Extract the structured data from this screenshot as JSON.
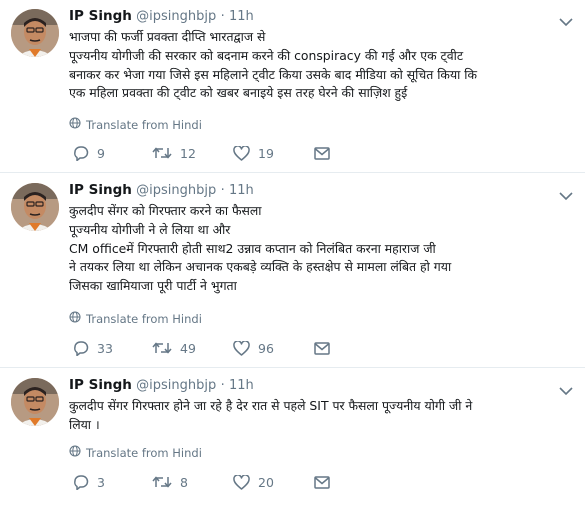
{
  "tweets": [
    {
      "name": "IP Singh",
      "handle": "@ipsinghbjp",
      "dot": "·",
      "time": "11h",
      "lines": [
        "भाजपा की फर्जी प्रवक्ता दीप्ति भारतद्वाज से",
        "पूज्यनीय योगीजी की सरकार को बदनाम करने की conspiracy की गई और एक ट्वीट",
        "बनाकर कर भेजा गया जिसे इस महिलाने ट्वीट किया उसके बाद मीडिया को सूचित किया कि",
        "एक महिला प्रवक्ता की ट्वीट को खबर बनाइये इस तरह घेरने की साज़िश हुई"
      ],
      "translate": "Translate from Hindi",
      "replies": "9",
      "retweets": "12",
      "likes": "19"
    },
    {
      "name": "IP Singh",
      "handle": "@ipsinghbjp",
      "dot": "·",
      "time": "11h",
      "lines": [
        "कुलदीप सेंगर को गिरफ्तार करने का फैसला",
        "पूज्यनीय योगीजी ने ले लिया था और",
        "CM officeमें गिरफ्तारी होती साथ2 उन्नाव कप्तान को निलंबित करना महाराज जी",
        "ने तयकर लिया था लेकिन अचानक एकबड़े व्यक्ति के हस्तक्षेप से मामला लंबित हो गया",
        "जिसका खामियाजा पूरी पार्टी ने भुगता"
      ],
      "translate": "Translate from Hindi",
      "replies": "33",
      "retweets": "49",
      "likes": "96"
    },
    {
      "name": "IP Singh",
      "handle": "@ipsinghbjp",
      "dot": "·",
      "time": "11h",
      "lines": [
        "कुलदीप सेंगर गिरफ्तार होने जा रहे है देर रात से पहले SIT पर फैसला पूज्यनीय योगी जी ने",
        "लिया ।"
      ],
      "translate": "Translate from Hindi",
      "replies": "3",
      "retweets": "8",
      "likes": "20"
    }
  ],
  "icons": {
    "reply": "reply-icon",
    "retweet": "retweet-icon",
    "like": "heart-icon",
    "dm": "envelope-icon",
    "caret": "chevron-down-icon",
    "translate": "globe-icon"
  },
  "colors": {
    "text": "#14171a",
    "muted": "#657786",
    "divider": "#e6ecf0"
  }
}
